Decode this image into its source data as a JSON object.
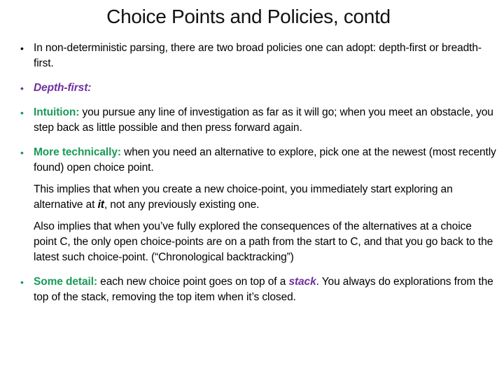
{
  "slide": {
    "title": "Choice Points and Policies, contd",
    "colors": {
      "purple": "#7030a0",
      "green": "#1a9a58"
    },
    "items": [
      {
        "text": "In non-deterministic parsing, there are two broad policies one can adopt: depth-first or breadth-first."
      },
      {
        "label": "Depth-first:"
      },
      {
        "label": "Intuition:",
        "text": " you pursue any line of investigation as far as it will go; when you meet an obstacle, you step back as little possible and then press forward again."
      },
      {
        "label": "More technically:",
        "text": " when you need an alternative to explore, pick one at the newest (most recently found) open choice point."
      },
      {
        "text_before": "This implies that when you create a new choice-point, you immediately start exploring an alternative at ",
        "emph": "it",
        "text_after": ", not any previously existing one."
      },
      {
        "text": "Also implies that when you’ve fully explored the consequences of the alternatives at a choice point C, the only open choice-points are on a path from the start to C, and that you go back to the latest such choice-point. (“Chronological backtracking”)"
      },
      {
        "label": "Some detail:",
        "text_before": " each new choice point goes on top of a ",
        "emph": "stack",
        "text_after": ". You always do explorations from the top of the stack, removing the top item when it’s closed."
      }
    ],
    "bullet_glyph": "•"
  }
}
